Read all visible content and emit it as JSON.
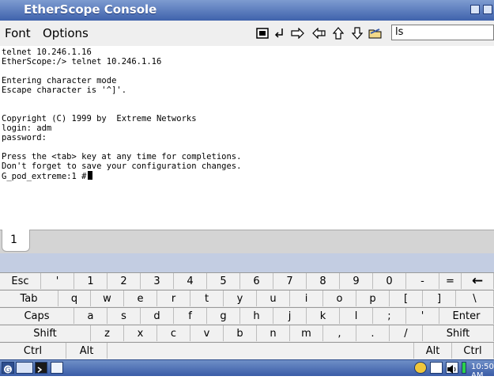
{
  "window": {
    "title": "EtherScope Console"
  },
  "menubar": {
    "items": [
      "Font",
      "Options"
    ],
    "command_value": "ls"
  },
  "toolbar": {
    "icons": [
      "terminal-icon",
      "enter-icon",
      "arrow-right-icon",
      "arrow-left-icon",
      "arrow-up-icon",
      "arrow-down-icon",
      "folder-icon"
    ]
  },
  "terminal": {
    "lines": [
      "telnet 10.246.1.16",
      "EtherScope:/> telnet 10.246.1.16",
      "",
      "Entering character mode",
      "Escape character is '^]'.",
      "",
      "",
      "Copyright (C) 1999 by  Extreme Networks",
      "login: adm",
      "password:",
      "",
      "Press the <tab> key at any time for completions.",
      "Don't forget to save your configuration changes.",
      "G_pod_extreme:1 #"
    ]
  },
  "tabs": {
    "items": [
      "1"
    ]
  },
  "keyboard": {
    "row1": [
      "Esc",
      "'",
      "1",
      "2",
      "3",
      "4",
      "5",
      "6",
      "7",
      "8",
      "9",
      "0",
      "-",
      "=",
      "←"
    ],
    "row2": [
      "Tab",
      "q",
      "w",
      "e",
      "r",
      "t",
      "y",
      "u",
      "i",
      "o",
      "p",
      "[",
      "]",
      "\\"
    ],
    "row3": [
      "Caps",
      "a",
      "s",
      "d",
      "f",
      "g",
      "h",
      "j",
      "k",
      "l",
      ";",
      "'",
      "Enter"
    ],
    "row4": [
      "Shift",
      "z",
      "x",
      "c",
      "v",
      "b",
      "n",
      "m",
      ",",
      ".",
      "/",
      "Shift"
    ],
    "row5": [
      "Ctrl",
      "Alt",
      "Alt",
      "Ctrl"
    ]
  },
  "taskbar": {
    "time": "10:50 AM"
  }
}
